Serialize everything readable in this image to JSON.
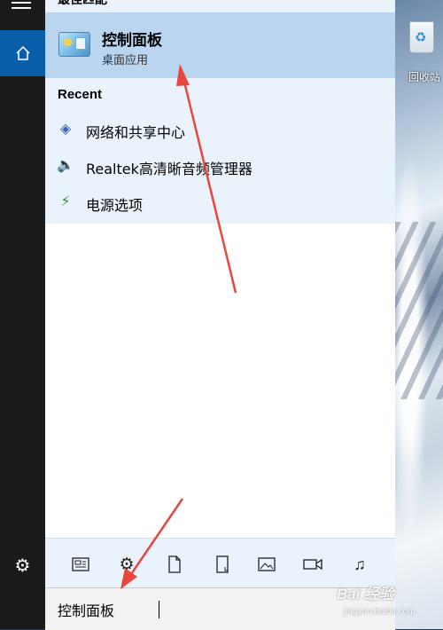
{
  "header": {
    "cut_title": "最佳匹配"
  },
  "best_match": {
    "title": "控制面板",
    "subtitle": "桌面应用"
  },
  "recent": {
    "label": "Recent",
    "items": [
      {
        "label": "网络和共享中心",
        "icon": "network-icon"
      },
      {
        "label": "Realtek高清晰音频管理器",
        "icon": "speaker-icon"
      },
      {
        "label": "电源选项",
        "icon": "power-icon"
      }
    ]
  },
  "filters": [
    "apps-filter-icon",
    "settings-filter-icon",
    "documents-filter-icon",
    "folders-filter-icon",
    "photos-filter-icon",
    "videos-filter-icon",
    "music-filter-icon"
  ],
  "search": {
    "value": "控制面板"
  },
  "desktop": {
    "recycle_bin_label": "回收站"
  },
  "watermark": {
    "text": "Bai 经验",
    "sub": "jingyan.baidu.com"
  },
  "colors": {
    "accent": "#0a5faa",
    "highlight": "#b9d5f0",
    "arrow": "#e8473d"
  }
}
